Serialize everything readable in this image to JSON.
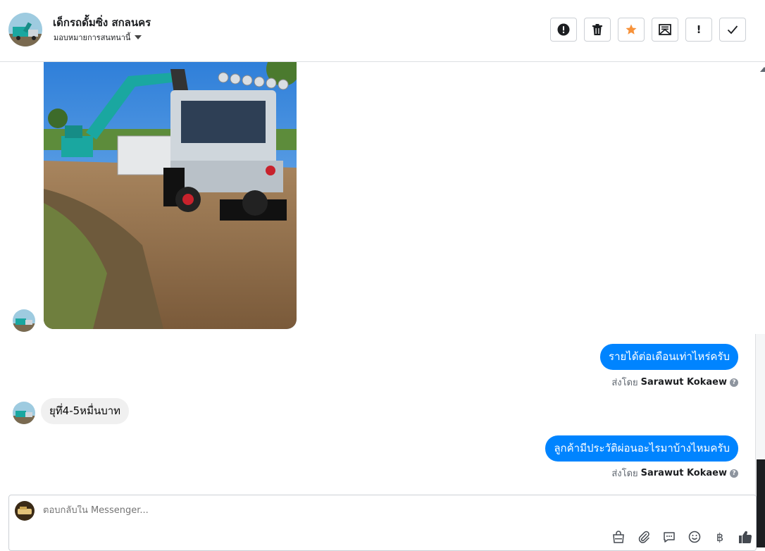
{
  "header": {
    "contact_name": "เด็กรถดั้มซิ่ง สกลนคร",
    "assign_label": "มอบหมายการสนทนานี้"
  },
  "toolbar": {
    "buttons": [
      "spam",
      "delete",
      "star",
      "move-to-inbox",
      "mark-follow-up",
      "mark-done"
    ],
    "follow_up_label": "!",
    "star_color": "#f7923a"
  },
  "messages": [
    {
      "direction": "in",
      "type": "photo",
      "description_icon": "dump-truck-excavator-photo"
    },
    {
      "direction": "out",
      "text": "รายได้ต่อเดือนเท่าไหร่ครับ",
      "sent_by_label": "ส่งโดย",
      "sender": "Sarawut Kokaew"
    },
    {
      "direction": "in",
      "text": "ยุทึ่4-5หมื่นบาท"
    },
    {
      "direction": "out",
      "text": "ลูกค้ามีประวัติผ่อนอะไรมาบ้างไหมครับ",
      "sent_by_label": "ส่งโดย",
      "sender": "Sarawut Kokaew"
    }
  ],
  "composer": {
    "placeholder": "ตอบกลับใน Messenger...",
    "icons": [
      "shop-icon",
      "attachment-icon",
      "saved-reply-icon",
      "emoji-icon",
      "baht-payment-icon",
      "thumbs-up-icon"
    ],
    "baht_symbol": "฿"
  },
  "colors": {
    "outgoing_bubble": "#0084ff",
    "incoming_bubble": "#f0f0f0",
    "accent": "#1877f2"
  }
}
